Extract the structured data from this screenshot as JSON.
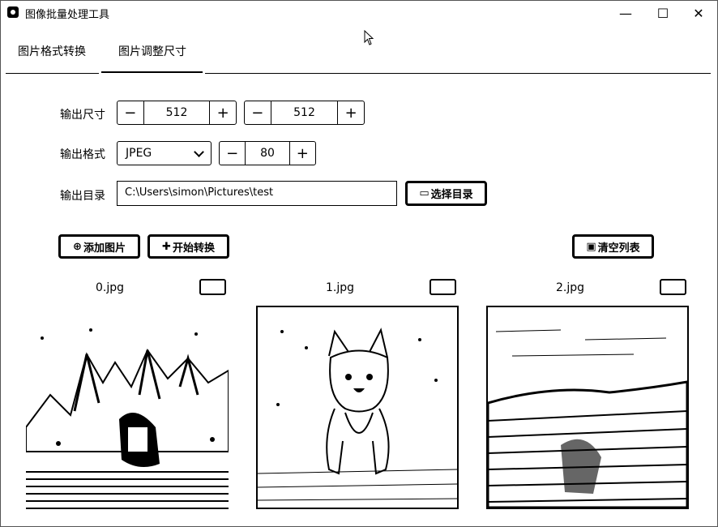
{
  "window": {
    "title": "图像批量处理工具",
    "minimize": "—",
    "maximize": "☐",
    "close": "✕"
  },
  "tabs": [
    {
      "label": "图片格式转换"
    },
    {
      "label": "图片调整尺寸"
    }
  ],
  "form": {
    "size_label": "输出尺寸",
    "width": "512",
    "height": "512",
    "format_label": "输出格式",
    "format": "JPEG",
    "quality": "80",
    "dir_label": "输出目录",
    "dir": "C:\\Users\\simon\\Pictures\\test",
    "choose_dir": "选择目录",
    "minus": "−",
    "plus": "+"
  },
  "actions": {
    "add": "添加图片",
    "start": "开始转换",
    "clear": "清空列表"
  },
  "images": [
    {
      "name": "0.jpg"
    },
    {
      "name": "1.jpg"
    },
    {
      "name": "2.jpg"
    }
  ]
}
